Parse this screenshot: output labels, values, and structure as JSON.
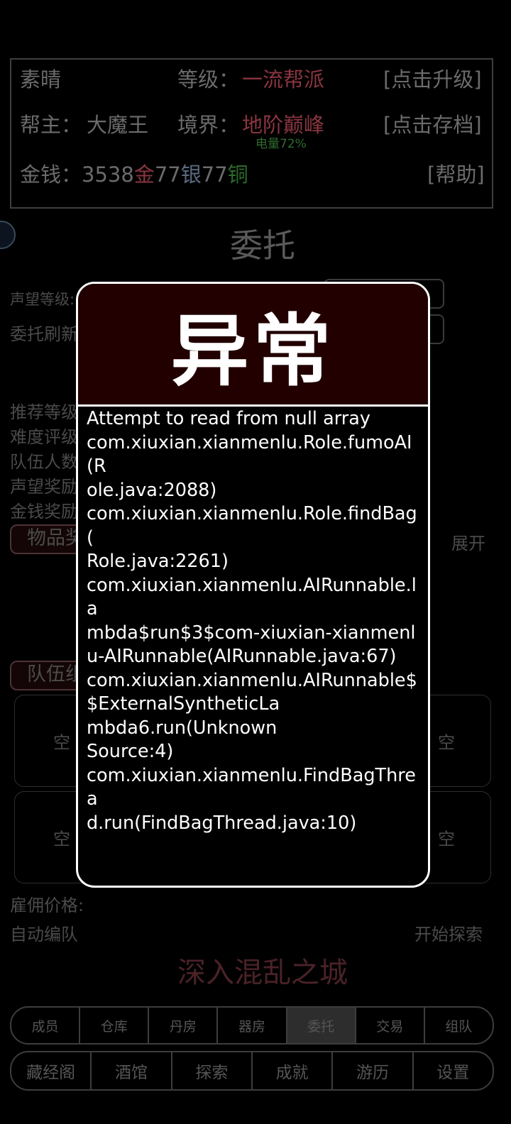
{
  "header": {
    "sect_name": "素晴",
    "level_label": "等级：",
    "level_value": "一流帮派",
    "upgrade_link": "[点击升级]",
    "leader_label": "帮主：",
    "leader_name": "大魔王",
    "realm_label": "境界：",
    "realm_value": "地阶巅峰",
    "save_link": "[点击存档]",
    "battery": "电量72%",
    "money_label": "金钱：",
    "gold_amount": "3538",
    "gold_unit": "金",
    "silver_amount": "77",
    "silver_unit": "银",
    "copper_amount": "77",
    "copper_unit": "铜",
    "help_link": "[帮助]"
  },
  "page": {
    "title": "委托",
    "reputation_label": "声望等级:",
    "refresh_label": "委托刷新",
    "recommend_label": "推荐等级",
    "difficulty_label": "难度评级",
    "team_size_label": "队伍人数",
    "rep_reward_label": "声望奖励",
    "money_reward_label": "金钱奖励",
    "items_pill": "物品奖",
    "expand_link": "展开",
    "team_pill": "队伍组",
    "empty_slot": "空",
    "hire_price_label": "雇佣价格:",
    "auto_team": "自动编队",
    "start_explore": "开始探索",
    "dungeon_title": "深入混乱之城"
  },
  "tabs_primary": [
    "成员",
    "仓库",
    "丹房",
    "器房",
    "委托",
    "交易",
    "组队"
  ],
  "tabs_primary_active": "委托",
  "tabs_secondary": [
    "藏经阁",
    "酒馆",
    "探索",
    "成就",
    "游历",
    "设置"
  ],
  "dialog": {
    "title": "异常",
    "lines": [
      "Attempt to read from null array",
      "com.xiuxian.xianmenlu.Role.fumoAI(R",
      "ole.java:2088)",
      "com.xiuxian.xianmenlu.Role.findBag(",
      "Role.java:2261)",
      "com.xiuxian.xianmenlu.AIRunnable.la",
      "mbda$run$3$com-xiuxian-xianmenl",
      "u-AIRunnable(AIRunnable.java:67)",
      "com.xiuxian.xianmenlu.AIRunnable$",
      "$ExternalSyntheticLa",
      "mbda6.run(Unknown",
      "Source:4)",
      "com.xiuxian.xianmenlu.FindBagThrea",
      "d.run(FindBagThread.java:10)"
    ]
  },
  "colors": {
    "accent_red": "#8a3540",
    "dialog_header_bg": "#220000",
    "copper_green": "#2c6b2c",
    "silver_blue": "#5a6a80"
  }
}
